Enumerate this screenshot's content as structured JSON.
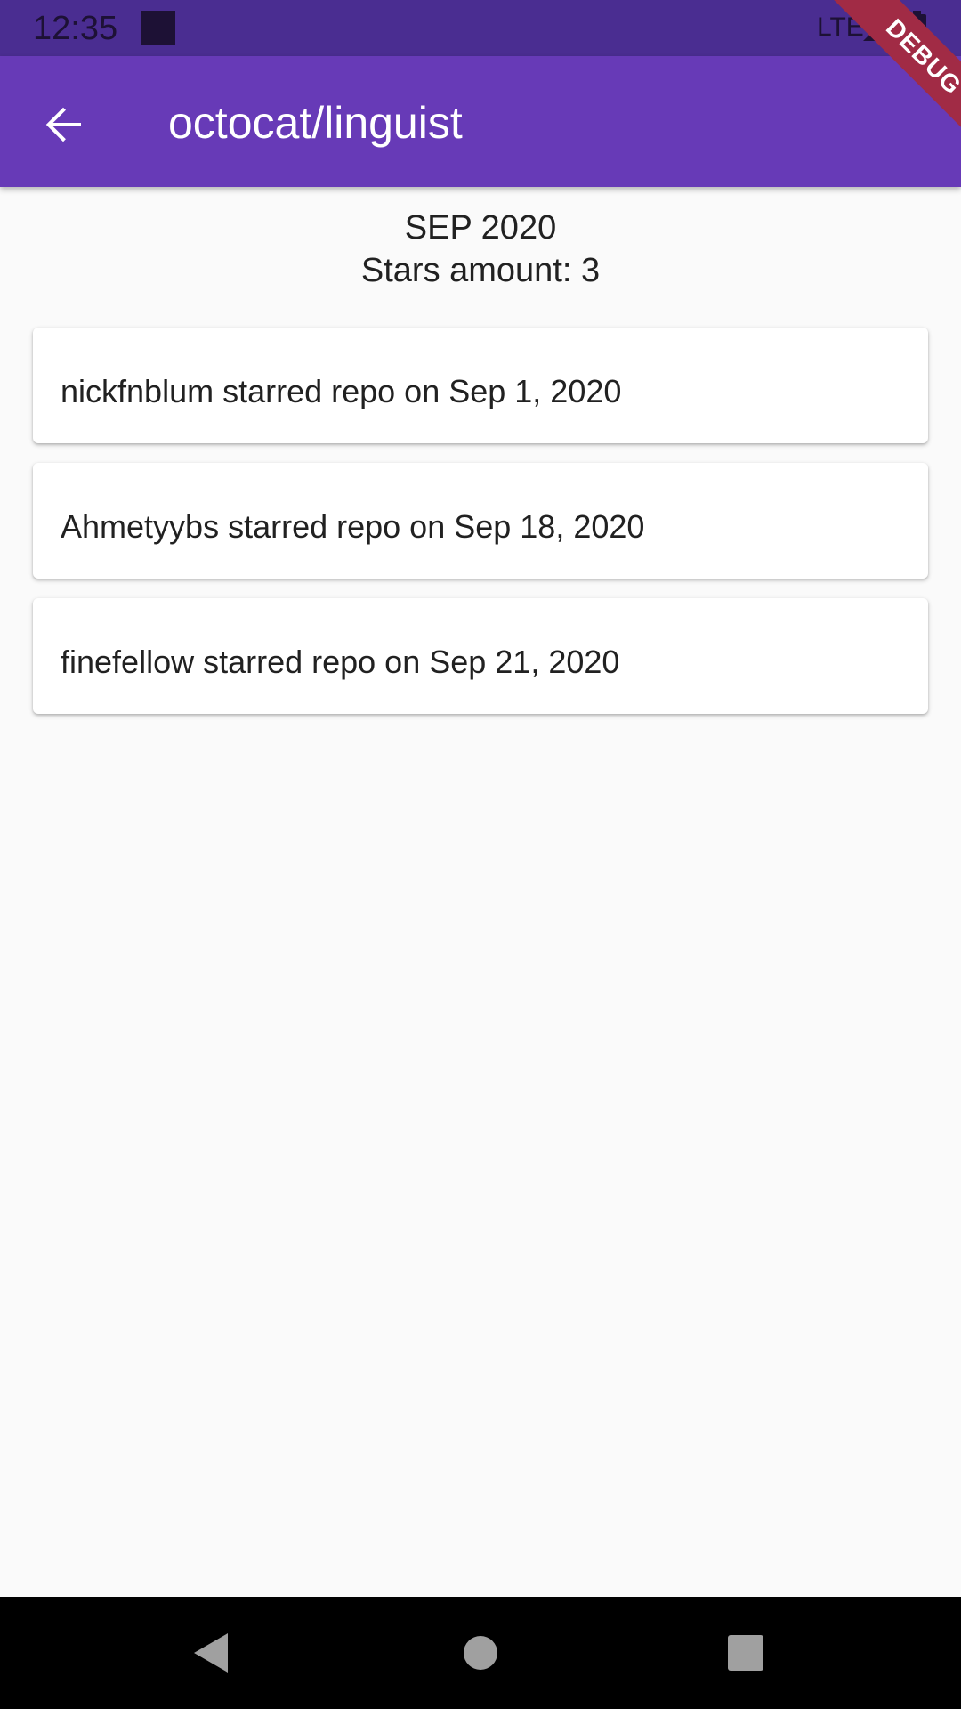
{
  "status_bar": {
    "time": "12:35",
    "network": "LTE",
    "square_icon": "notification-square-icon",
    "signal_icon": "signal-icon",
    "battery_icon": "battery-icon"
  },
  "app_bar": {
    "back_icon": "arrow-back-icon",
    "title": "octocat/linguist",
    "debug_banner": "DEBUG"
  },
  "summary": {
    "month": "SEP 2020",
    "stars": "Stars amount: 3"
  },
  "stargazers": [
    {
      "text": "nickfnblum starred repo on Sep 1, 2020"
    },
    {
      "text": "Ahmetyybs starred repo on Sep 18, 2020"
    },
    {
      "text": "finefellow starred repo on Sep 21, 2020"
    }
  ],
  "nav_bar": {
    "back_icon": "nav-back-icon",
    "home_icon": "nav-home-icon",
    "recents_icon": "nav-recents-icon"
  },
  "colors": {
    "app_bar": "#673ab7",
    "status_bar": "#4a2d91",
    "background": "#fafafa",
    "debug_ribbon": "#a12b45"
  }
}
